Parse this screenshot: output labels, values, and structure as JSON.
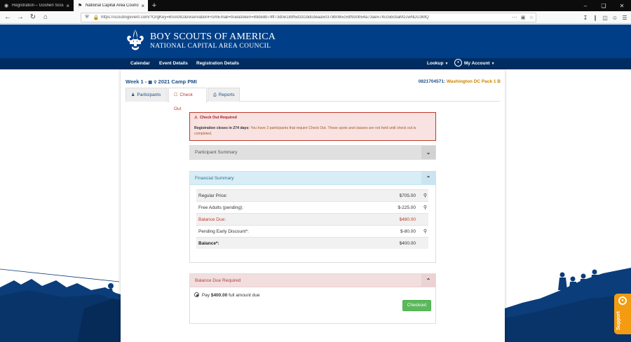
{
  "browser": {
    "tabs": [
      {
        "title": "Registration – Goshen Scout R"
      },
      {
        "title": "National Capital Area Council |"
      }
    ],
    "url": "https://scoutingevent.com/?OrgKey=BSA082&reservationFromEmail=true&token=89de8b74ff73d0e189f5d331bdcdeaa50378b085c59f930b54a73ae574cc5bcbaM1cwNDU3MQ"
  },
  "site": {
    "brand_line1": "BOY SCOUTS OF AMERICA",
    "brand_line2": "NATIONAL CAPITAL AREA COUNCIL",
    "menu": {
      "calendar": "Calendar",
      "event_details": "Event Details",
      "registration_details": "Registration Details",
      "lookup": "Lookup",
      "my_account": "My Account"
    }
  },
  "page": {
    "title_prefix": "Week 1 -",
    "title_event": "2021 Camp PMI",
    "record_id": "0821704571:",
    "record_name": "Washington DC Pack 1 B",
    "tabs": {
      "participants": "Participants",
      "checkout": "Check Out",
      "reports": "Reports"
    },
    "alert": {
      "heading": "Check Out Required",
      "bold": "Registration closes in 274 days:",
      "body": "You have 2 participants that require Check Out. These spots and classes are not held until check out is completed."
    },
    "participant_summary": "Participant Summary",
    "financial_summary": {
      "heading": "Financial Summary",
      "rows": [
        {
          "label": "Regular Price:",
          "value": "$705.00"
        },
        {
          "label": "Free Adults (pending):",
          "value": "$-225.00"
        },
        {
          "label": "Balance Due:",
          "value": "$480.00"
        },
        {
          "label": "Pending Early Discount*:",
          "value": "$-80.00"
        },
        {
          "label": "Balance*:",
          "value": "$400.00"
        }
      ]
    },
    "balance_due": {
      "heading": "Balance Due Required",
      "pay_prefix": "Pay",
      "pay_amount": "$400.00",
      "pay_suffix": "full amount due",
      "checkout_button": "Checkout"
    },
    "support": "Support"
  },
  "colors": {
    "header_blue": "#003f87",
    "menu_blue": "#002d61",
    "alert_red": "#c0392b",
    "checkout_green": "#5cb85c",
    "support_orange": "#f39c12"
  }
}
